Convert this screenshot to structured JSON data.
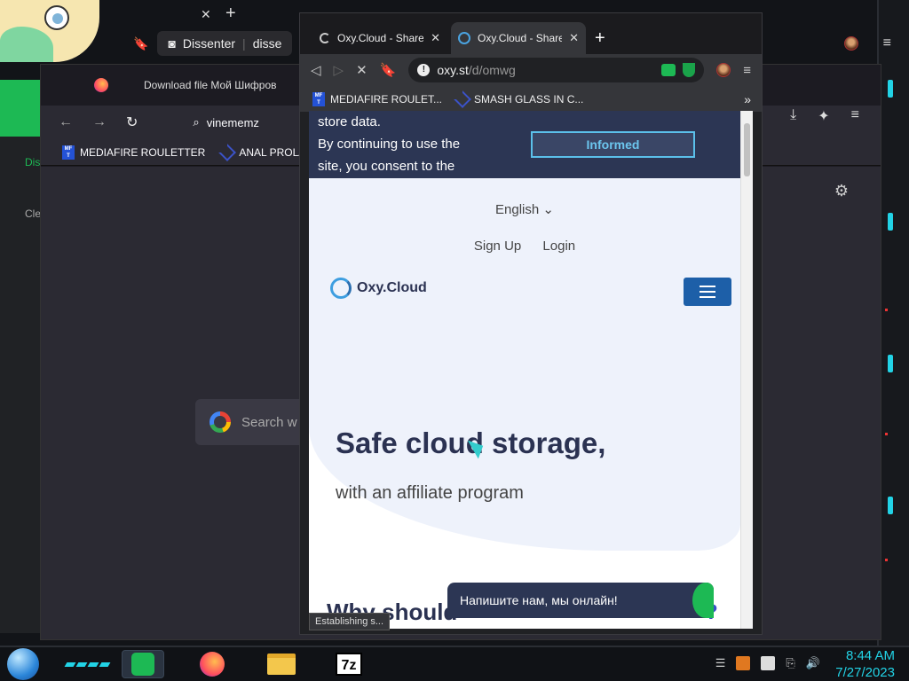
{
  "desktop": {
    "accent_color": "#22d3e6"
  },
  "background_browser": {
    "tab": {
      "label": "Download file Мой Шифров"
    },
    "url_text": "vinememz",
    "bookmarks": [
      {
        "label": "MEDIAFIRE ROULETTER",
        "icon": "mediafire-icon"
      },
      {
        "label": "ANAL PROLAPS",
        "icon": "smash-icon"
      }
    ],
    "search_placeholder": "Search w",
    "left_panel": {
      "item_1": "Dis",
      "item_2": "Cle"
    }
  },
  "top_window": {
    "tab_label": "Dissenter",
    "tab_label_2": "disse"
  },
  "front_browser": {
    "tabs": [
      {
        "label": "Oxy.Cloud - Share",
        "state": "loading"
      },
      {
        "label": "Oxy.Cloud - Share",
        "state": "active"
      }
    ],
    "url": {
      "domain": "oxy.st",
      "path": "/d/omwg"
    },
    "bookmarks": [
      {
        "label": "MEDIAFIRE ROULET...",
        "icon": "mediafire-icon"
      },
      {
        "label": "SMASH GLASS IN C...",
        "icon": "smash-icon"
      }
    ],
    "more_label": "»",
    "status_text": "Establishing s..."
  },
  "page": {
    "cookie": {
      "text_line1": "store data.",
      "text_line2": "By continuing to use the",
      "text_line3": "site, you consent to the",
      "button": "Informed"
    },
    "language": "English",
    "auth": {
      "signup": "Sign Up",
      "login": "Login"
    },
    "logo": "Oxy.Cloud",
    "headline": "Safe cloud storage,",
    "subline": "with an affiliate program",
    "why_heading": "Why should",
    "why_q": "?",
    "chat_text": "Напишите нам, мы онлайн!",
    "brand_color": "#2b3252",
    "button_color": "#1d5fa8"
  },
  "taskbar": {
    "apps": [
      "spotify",
      "firefox",
      "file-explorer",
      "7zip"
    ],
    "sevenz_label": "7z",
    "clock": {
      "time": "8:44 AM",
      "date": "7/27/2023"
    }
  }
}
